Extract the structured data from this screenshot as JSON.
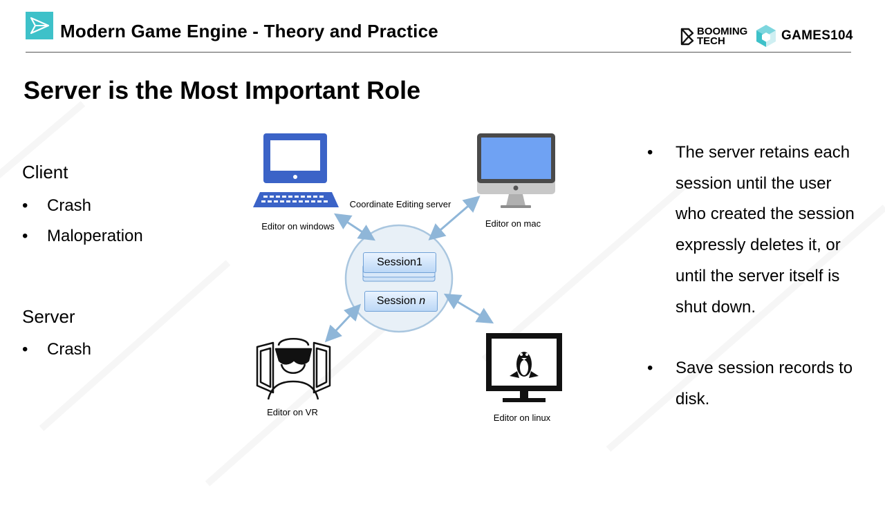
{
  "header": {
    "title": "Modern Game Engine - Theory and Practice",
    "brand_booming": [
      "BOOMING",
      "TECH"
    ],
    "brand_games": "GAMES104"
  },
  "slide": {
    "title": "Server is the Most Important Role"
  },
  "left_panel": {
    "client_heading": "Client",
    "client_items": [
      "Crash",
      "Maloperation"
    ],
    "server_heading": "Server",
    "server_items": [
      "Crash"
    ],
    "bullet": "•"
  },
  "diagram": {
    "server_label": "Coordinate Editing server",
    "sessions": [
      {
        "label": "Session1"
      },
      {
        "label_prefix": "Session ",
        "label_var": "n"
      }
    ],
    "editors": {
      "windows": "Editor on windows",
      "mac": "Editor on mac",
      "vr": "Editor on VR",
      "linux": "Editor on linux"
    }
  },
  "notes": [
    "The server retains each session until the user who created the session expressly deletes it, or until the server itself is shut down.",
    "Save session records to disk."
  ],
  "colors": {
    "accent_logo": "#3ec1c9",
    "windows_pc": "#3b63c7",
    "mac_screen": "#6fa2f3",
    "arrow": "#8fb6d8",
    "server_circle_fill": "#e8f0f7",
    "server_circle_stroke": "#a9c6df"
  }
}
